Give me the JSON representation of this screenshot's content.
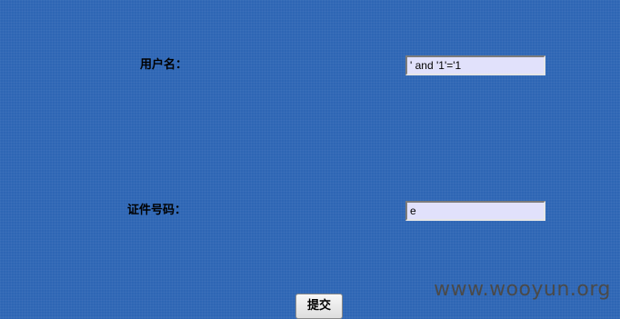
{
  "form": {
    "username_label": "用户名：",
    "username_value": "' and '1'='1",
    "id_number_label": "证件号码：",
    "id_number_value": "e",
    "submit_label": "提交"
  },
  "watermark": {
    "text": "www.wooyun.org"
  }
}
